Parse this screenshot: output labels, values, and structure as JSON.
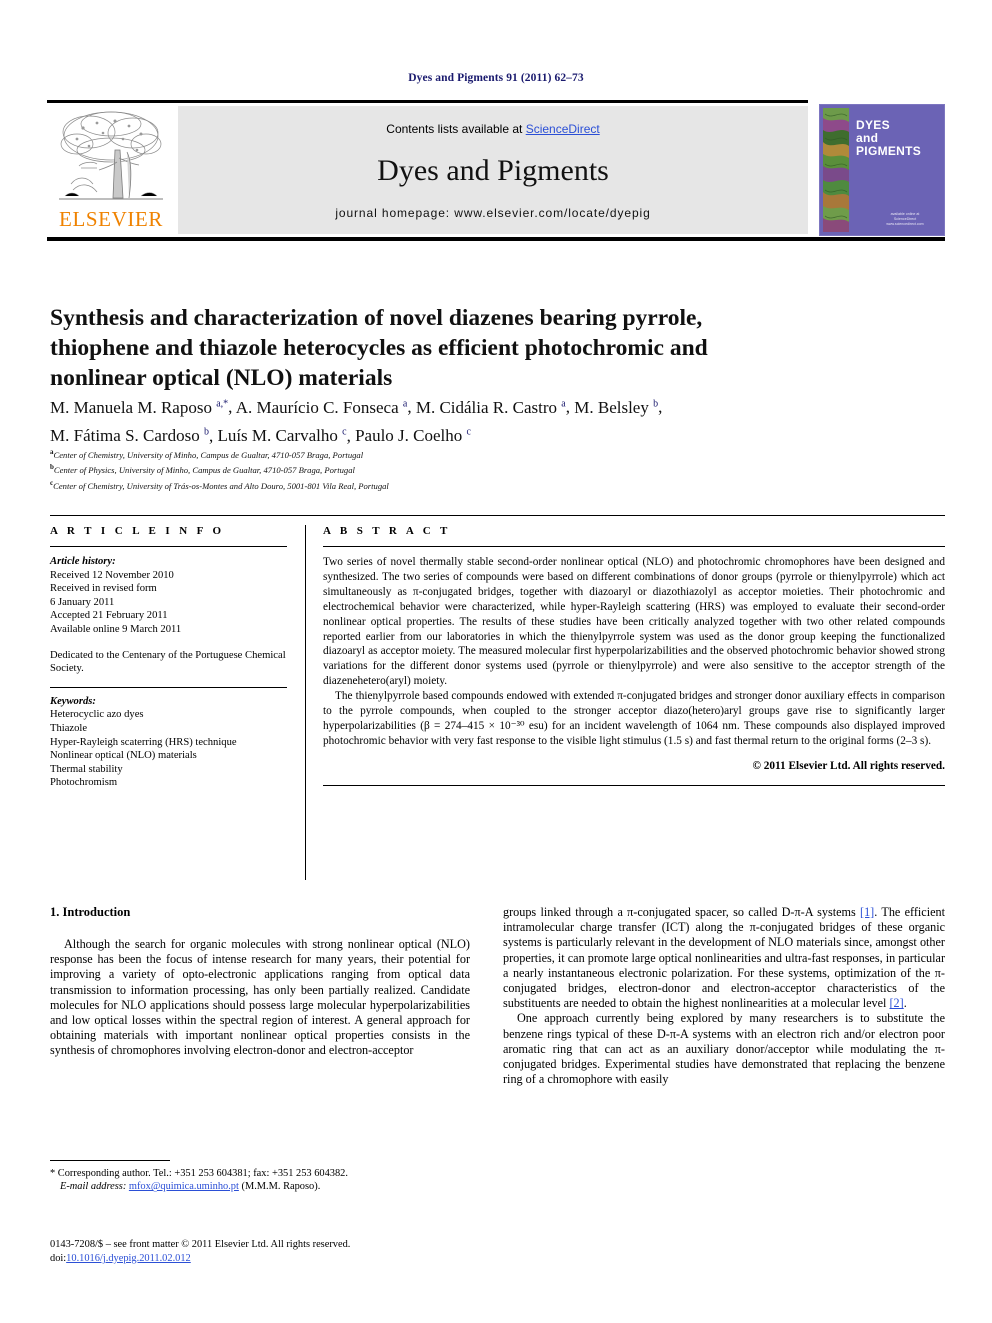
{
  "running_head": "Dyes and Pigments 91 (2011) 62–73",
  "masthead": {
    "contents_prefix": "Contents lists available at ",
    "sciencedirect": "ScienceDirect",
    "journal_title": "Dyes and Pigments",
    "homepage": "journal homepage: www.elsevier.com/locate/dyepig",
    "publisher_wordmark": "ELSEVIER",
    "cover_title": "DYES and PIGMENTS",
    "cover_footer": "published by\nScienceDirect\nwww.sciencedirect.com",
    "sciencedirect_color": "#2b4fd6",
    "elsevier_orange": "#ef8200",
    "cover_purple": "#6b63b5"
  },
  "article": {
    "title": "Synthesis and characterization of novel diazenes bearing pyrrole, thiophene and thiazole heterocycles as efficient photochromic and nonlinear optical (NLO) materials",
    "authors_line_1": "M. Manuela M. Raposo",
    "authors": [
      {
        "name": "M. Manuela M. Raposo",
        "sup": "a,*"
      },
      {
        "name": "A. Maurício C. Fonseca",
        "sup": "a"
      },
      {
        "name": "M. Cidália R. Castro",
        "sup": "a"
      },
      {
        "name": "M. Belsley",
        "sup": "b"
      },
      {
        "name": "M. Fátima S. Cardoso",
        "sup": "b"
      },
      {
        "name": "Luís M. Carvalho",
        "sup": "c"
      },
      {
        "name": "Paulo J. Coelho",
        "sup": "c"
      }
    ],
    "affiliations": [
      {
        "marker": "a",
        "text": "Center of Chemistry, University of Minho, Campus de Gualtar, 4710-057 Braga, Portugal"
      },
      {
        "marker": "b",
        "text": "Center of Physics, University of Minho, Campus de Gualtar, 4710-057 Braga, Portugal"
      },
      {
        "marker": "c",
        "text": "Center of Chemistry, University of Trás-os-Montes and Alto Douro, 5001-801 Vila Real, Portugal"
      }
    ]
  },
  "article_info": {
    "heading": "A R T I C L E  I N F O",
    "history_label": "Article history:",
    "history": [
      "Received 12 November 2010",
      "Received in revised form",
      "6 January 2011",
      "Accepted 21 February 2011",
      "Available online 9 March 2011"
    ],
    "dedication": "Dedicated to the Centenary of the Portuguese Chemical Society.",
    "keywords_label": "Keywords:",
    "keywords": [
      "Heterocyclic azo dyes",
      "Thiazole",
      "Hyper-Rayleigh scaterring (HRS) technique",
      "Nonlinear optical (NLO) materials",
      "Thermal stability",
      "Photochromism"
    ]
  },
  "abstract": {
    "heading": "A B S T R A C T",
    "paragraphs": [
      "Two series of novel thermally stable second-order nonlinear optical (NLO) and photochromic chromophores have been designed and synthesized. The two series of compounds were based on different combinations of donor groups (pyrrole or thienylpyrrole) which act simultaneously as π-conjugated bridges, together with diazoaryl or diazothiazolyl as acceptor moieties. Their photochromic and electrochemical behavior were characterized, while hyper-Rayleigh scattering (HRS) was employed to evaluate their second-order nonlinear optical properties. The results of these studies have been critically analyzed together with two other related compounds reported earlier from our laboratories in which the thienylpyrrole system was used as the donor group keeping the functionalized diazoaryl as acceptor moiety. The measured molecular first hyperpolarizabilities and the observed photochromic behavior showed strong variations for the different donor systems used (pyrrole or thienylpyrrole) and were also sensitive to the acceptor strength of the diazenehetero(aryl) moiety.",
      "The thienylpyrrole based compounds endowed with extended π-conjugated bridges and stronger donor auxiliary effects in comparison to the pyrrole compounds, when coupled to the stronger acceptor diazo(hetero)aryl groups gave rise to significantly larger hyperpolarizabilities (β = 274–415 × 10⁻³⁰ esu) for an incident wavelength of 1064 nm. These compounds also displayed improved photochromic behavior with very fast response to the visible light stimulus (1.5 s) and fast thermal return to the original forms (2–3 s)."
    ],
    "copyright": "© 2011 Elsevier Ltd. All rights reserved."
  },
  "body": {
    "section_heading": "1. Introduction",
    "left_paragraphs": [
      "Although the search for organic molecules with strong nonlinear optical (NLO) response has been the focus of intense research for many years, their potential for improving a variety of opto-electronic applications ranging from optical data transmission to information processing, has only been partially realized. Candidate molecules for NLO applications should possess large molecular hyperpolarizabilities and low optical losses within the spectral region of interest. A general approach for obtaining materials with important nonlinear optical properties consists in the synthesis of chromophores involving electron-donor and electron-acceptor"
    ],
    "right_paragraph_1_a": "groups linked through a π-conjugated spacer, so called D-π-A systems ",
    "right_ref_1": "[1]",
    "right_paragraph_1_b": ". The efficient intramolecular charge transfer (ICT) along the π-conjugated bridges of these organic systems is particularly relevant in the development of NLO materials since, amongst other properties, it can promote large optical nonlinearities and ultra-fast responses, in particular a nearly instantaneous electronic polarization. For these systems, optimization of the π-conjugated bridges, electron-donor and electron-acceptor characteristics of the substituents are needed to obtain the highest nonlinearities at a molecular level ",
    "right_ref_2": "[2]",
    "right_paragraph_1_c": ".",
    "right_paragraph_2": "One approach currently being explored by many researchers is to substitute the benzene rings typical of these D-π-A systems with an electron rich and/or electron poor aromatic ring that can act as an auxiliary donor/acceptor while modulating the π-conjugated bridges. Experimental studies have demonstrated that replacing the benzene ring of a chromophore with easily"
  },
  "footnote": {
    "corresponding": "* Corresponding author. Tel.: +351 253 604381; fax: +351 253 604382.",
    "email_label": "E-mail address:",
    "email": "mfox@quimica.uminho.pt",
    "email_attrib": "(M.M.M. Raposo).",
    "imprint": "0143-7208/$ – see front matter © 2011 Elsevier Ltd. All rights reserved.",
    "doi_label": "doi:",
    "doi": "10.1016/j.dyepig.2011.02.012"
  }
}
